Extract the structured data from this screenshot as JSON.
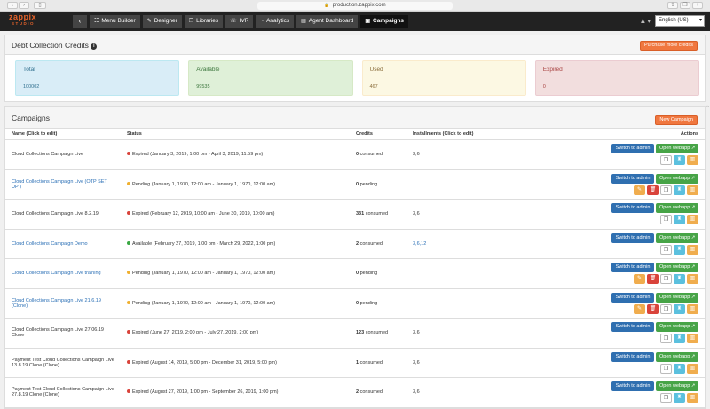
{
  "browser": {
    "url": "production.zappix.com"
  },
  "logo": {
    "line1": "zappix",
    "line2": "STUDIO"
  },
  "nav": {
    "back_glyph": "‹",
    "items": [
      {
        "label": "Menu Builder",
        "icon": "sitemap-icon",
        "glyph": "☷"
      },
      {
        "label": "Designer",
        "icon": "pencil-icon",
        "glyph": "✎"
      },
      {
        "label": "Libraries",
        "icon": "library-icon",
        "glyph": "❐"
      },
      {
        "label": "IVR",
        "icon": "phone-icon",
        "glyph": "☏"
      },
      {
        "label": "Analytics",
        "icon": "pie-chart-icon",
        "glyph": "◔"
      },
      {
        "label": "Agent Dashboard",
        "icon": "agent-icon",
        "glyph": "▤"
      },
      {
        "label": "Campaigns",
        "icon": "campaigns-icon",
        "glyph": "▣",
        "active": true
      }
    ],
    "language": "English (US)"
  },
  "credits": {
    "title": "Debt Collection Credits",
    "purchase_label": "Purchase more credits",
    "total": {
      "label": "Total",
      "value": "100002"
    },
    "available": {
      "label": "Available",
      "value": "99535"
    },
    "used": {
      "label": "Used",
      "value": "467"
    },
    "expired": {
      "label": "Expired",
      "value": "0"
    }
  },
  "campaigns": {
    "title": "Campaigns",
    "new_label": "New Campaign",
    "headers": {
      "name": "Name (Click to edit)",
      "status": "Status",
      "credits": "Credits",
      "installments": "Installments (Click to edit)",
      "actions": "Actions"
    },
    "switch_label": "Switch to admin",
    "open_label": "Open webapp",
    "rows": [
      {
        "name": "Cloud Collections Campaign Live",
        "link": false,
        "status": "expired",
        "status_text": "Expired (January 3, 2019, 1:00 pm - April 3, 2019, 11:59 pm)",
        "credits_num": "0",
        "credits_word": "consumed",
        "installments": "3,6",
        "inst_link": false,
        "editable": false
      },
      {
        "name": "Cloud Collections Campaign Live (OTP SET UP )",
        "link": true,
        "status": "pending",
        "status_text": "Pending (January 1, 1970, 12:00 am - January 1, 1970, 12:00 am)",
        "credits_num": "0",
        "credits_word": "pending",
        "installments": "",
        "inst_link": false,
        "editable": true
      },
      {
        "name": "Cloud Collections Campaign Live 8.2.19",
        "link": false,
        "status": "expired",
        "status_text": "Expired (February 12, 2019, 10:00 am - June 30, 2019, 10:00 am)",
        "credits_num": "331",
        "credits_word": "consumed",
        "installments": "3,6",
        "inst_link": false,
        "editable": false
      },
      {
        "name": "Cloud Collections Campaign Demo",
        "link": true,
        "status": "available",
        "status_text": "Available (February 27, 2019, 1:00 pm - March 29, 2022, 1:00 pm)",
        "credits_num": "2",
        "credits_word": "consumed",
        "installments": "3,6,12",
        "inst_link": true,
        "editable": false
      },
      {
        "name": "Cloud Collections Campaign Live training",
        "link": true,
        "status": "pending",
        "status_text": "Pending (January 1, 1970, 12:00 am - January 1, 1970, 12:00 am)",
        "credits_num": "0",
        "credits_word": "pending",
        "installments": "",
        "inst_link": false,
        "editable": true
      },
      {
        "name": "Cloud Collections Campaign Live 21.6.19 (Clone)",
        "link": true,
        "status": "pending",
        "status_text": "Pending (January 1, 1970, 12:00 am - January 1, 1970, 12:00 am)",
        "credits_num": "0",
        "credits_word": "pending",
        "installments": "",
        "inst_link": false,
        "editable": true
      },
      {
        "name": "Cloud Collections Campaign Live 27.06.19 Clone",
        "link": false,
        "status": "expired",
        "status_text": "Expired (June 27, 2019, 2:00 pm - July 27, 2019, 2:00 pm)",
        "credits_num": "123",
        "credits_word": "consumed",
        "installments": "3,6",
        "inst_link": false,
        "editable": false
      },
      {
        "name": "Payment Test Cloud Collections Campaign Live 13.8.19 Clone (Clone)",
        "link": false,
        "status": "expired",
        "status_text": "Expired (August 14, 2019, 5:00 pm - December 31, 2019, 5:00 pm)",
        "credits_num": "1",
        "credits_word": "consumed",
        "installments": "3,6",
        "inst_link": false,
        "editable": false
      },
      {
        "name": "Payment Test Cloud Collections Campaign Live 27.8.19 Clone (Clone)",
        "link": false,
        "status": "expired",
        "status_text": "Expired (August 27, 2019, 1:00 pm - September 26, 2019, 1:00 pm)",
        "credits_num": "2",
        "credits_word": "consumed",
        "installments": "3,6",
        "inst_link": false,
        "editable": false
      }
    ]
  },
  "colors": {
    "accent": "#f0773f",
    "primary": "#2f6fb0",
    "success": "#47a447",
    "danger": "#d9433b",
    "warning": "#f0ad4e",
    "info": "#5bc0de"
  }
}
